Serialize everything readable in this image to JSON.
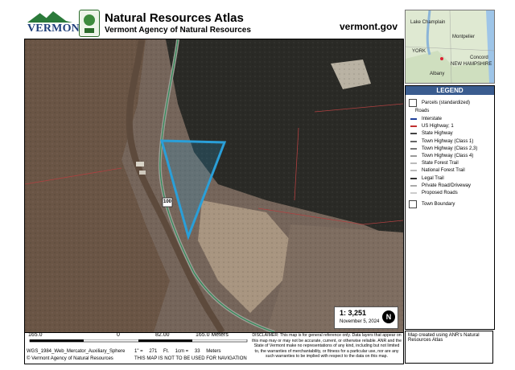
{
  "header": {
    "brand": "VERMONT",
    "title": "Natural Resources Atlas",
    "subtitle": "Vermont Agency of Natural Resources",
    "website": "vermont.gov"
  },
  "map": {
    "road_shield": "100",
    "scale_ratio": "1:  3,251",
    "date": "November 5, 2024",
    "north_label": "N"
  },
  "scalebar": {
    "left": "165.0",
    "zero": "0",
    "mid": "82.00",
    "right": "165.0 Meters"
  },
  "footer": {
    "projection": "WGS_1984_Web_Mercator_Auxiliary_Sphere",
    "copyright": "© Vermont Agency of Natural Resources",
    "unit_inch": "1\" =",
    "unit_value": "271",
    "unit_ft": "Ft.",
    "unit_cm": "1cm =",
    "unit_cm_value": "33",
    "unit_meters": "Meters",
    "nav_note": "THIS MAP IS NOT TO BE USED FOR NAVIGATION",
    "disclaimer": "DISCLAIMER: This map is for general reference only. Data layers that appear on this map may or may not be accurate, current, or otherwise reliable. ANR and the State of Vermont make no representations of any kind, including but not limited to, the warranties of merchantability, or fitness for a particular use, nor are any such warranties to be implied with respect to the data on this map."
  },
  "inset": {
    "labels": [
      "Lake Champlain",
      "Montpelier",
      "YORK",
      "NEW HAMPSHIRE",
      "Concord",
      "Albany"
    ]
  },
  "legend": {
    "title": "LEGEND",
    "parcels": "Parcels (standardized)",
    "roads": "Roads",
    "items": [
      {
        "label": "Interstate",
        "color": "#1f3f9a"
      },
      {
        "label": "US Highway; 1",
        "color": "#c03030"
      },
      {
        "label": "State Highway",
        "color": "#444444"
      },
      {
        "label": "Town Highway (Class 1)",
        "color": "#666666"
      },
      {
        "label": "Town Highway (Class 2,3)",
        "color": "#777777"
      },
      {
        "label": "Town Highway (Class 4)",
        "color": "#999999"
      },
      {
        "label": "State Forest Trail",
        "color": "#bbbbbb"
      },
      {
        "label": "National Forest Trail",
        "color": "#bbbbbb"
      },
      {
        "label": "Legal Trail",
        "color": "#333333"
      },
      {
        "label": "Private Road/Driveway",
        "color": "#aaaaaa"
      },
      {
        "label": "Proposed Roads",
        "color": "#cccccc"
      }
    ],
    "town_boundary": "Town Boundary"
  },
  "credit": {
    "text": "Map created using ANR's Natural Resources Atlas"
  },
  "colors": {
    "parcel_highlight": "#2a9fd8",
    "legend_header": "#3a5c8f",
    "road_green": "#2e8b57",
    "boundary_red": "#b04040"
  }
}
